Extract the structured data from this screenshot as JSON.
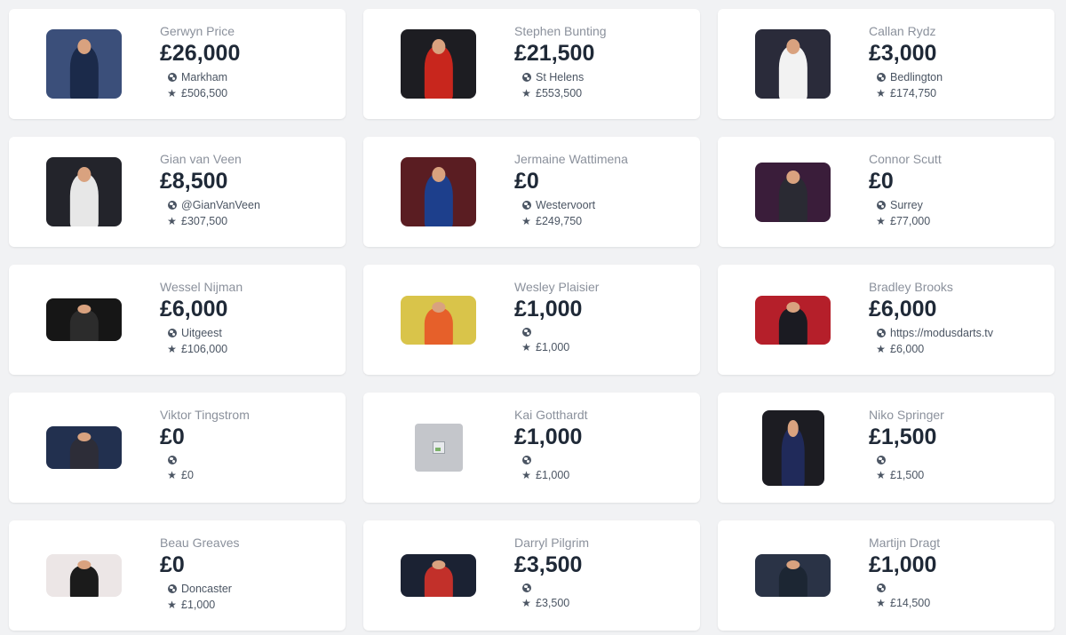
{
  "players": [
    {
      "name": "Gerwyn Price",
      "prize": "£26,000",
      "location": "Markham",
      "total": "£506,500",
      "bg": "#3b4f7a",
      "kit": "#1b2a4a"
    },
    {
      "name": "Stephen Bunting",
      "prize": "£21,500",
      "location": "St Helens",
      "total": "£553,500",
      "bg": "#1d1d22",
      "kit": "#c8261d"
    },
    {
      "name": "Callan Rydz",
      "prize": "£3,000",
      "location": "Bedlington",
      "total": "£174,750",
      "bg": "#2a2b3a",
      "kit": "#f2f2f2"
    },
    {
      "name": "Gian van Veen",
      "prize": "£8,500",
      "location": "@GianVanVeen",
      "total": "£307,500",
      "bg": "#23242b",
      "kit": "#e7e7e7"
    },
    {
      "name": "Jermaine Wattimena",
      "prize": "£0",
      "location": "Westervoort",
      "total": "£249,750",
      "bg": "#5a1d22",
      "kit": "#1d3f8c"
    },
    {
      "name": "Connor Scutt",
      "prize": "£0",
      "location": "Surrey",
      "total": "£77,000",
      "bg": "#3a1d3a",
      "kit": "#2a2a33"
    },
    {
      "name": "Wessel Nijman",
      "prize": "£6,000",
      "location": "Uitgeest",
      "total": "£106,000",
      "bg": "#161616",
      "kit": "#2c2c2c"
    },
    {
      "name": "Wesley Plaisier",
      "prize": "£1,000",
      "location": "",
      "total": "£1,000",
      "bg": "#d9c44a",
      "kit": "#e6602a"
    },
    {
      "name": "Bradley Brooks",
      "prize": "£6,000",
      "location": "https://modusdarts.tv",
      "total": "£6,000",
      "bg": "#b51f2a",
      "kit": "#1b1b22"
    },
    {
      "name": "Viktor Tingstrom",
      "prize": "£0",
      "location": "",
      "total": "£0",
      "bg": "#22304f",
      "kit": "#2d2d38"
    },
    {
      "name": "Kai Gotthardt",
      "prize": "£1,000",
      "location": "",
      "total": "£1,000",
      "bg": "",
      "kit": ""
    },
    {
      "name": "Niko Springer",
      "prize": "£1,500",
      "location": "",
      "total": "£1,500",
      "bg": "#1c1c22",
      "kit": "#202a5a"
    },
    {
      "name": "Beau Greaves",
      "prize": "£0",
      "location": "Doncaster",
      "total": "£1,000",
      "bg": "#ece6e6",
      "kit": "#1b1b1b"
    },
    {
      "name": "Darryl Pilgrim",
      "prize": "£3,500",
      "location": "",
      "total": "£3,500",
      "bg": "#1b2233",
      "kit": "#c2302a"
    },
    {
      "name": "Martijn Dragt",
      "prize": "£1,000",
      "location": "",
      "total": "£14,500",
      "bg": "#2a3346",
      "kit": "#1c2633"
    }
  ]
}
